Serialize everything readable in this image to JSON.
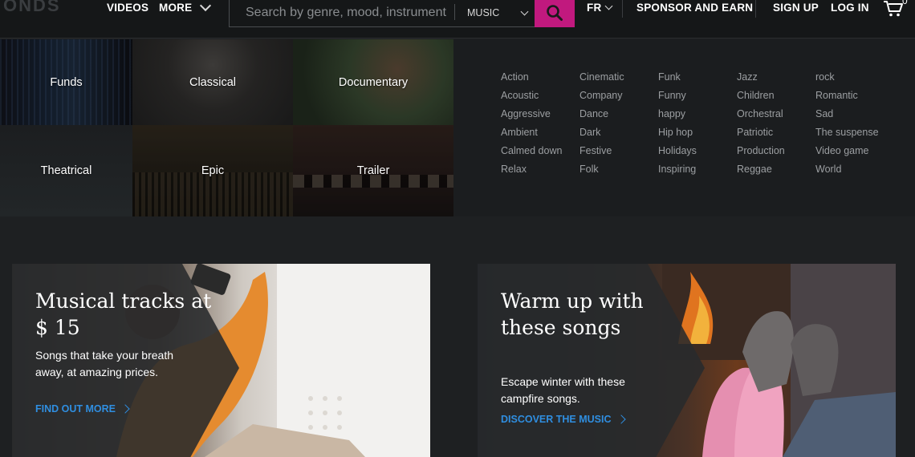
{
  "header": {
    "logo_text": "ONDS",
    "nav": {
      "videos": "VIDEOS",
      "more": "MORE",
      "language": "FR",
      "sponsor": "SPONSOR AND EARN",
      "signup": "SIGN UP",
      "login": "LOG IN"
    },
    "search": {
      "placeholder": "Search by genre, mood, instrument",
      "category": "MUSIC"
    },
    "cart_count": "0",
    "accent_color": "#c1197e"
  },
  "mega_menu": {
    "tiles": [
      {
        "label": "Funds"
      },
      {
        "label": "Classical"
      },
      {
        "label": "Documentary"
      },
      {
        "label": "Theatrical"
      },
      {
        "label": "Epic"
      },
      {
        "label": "Trailer"
      }
    ],
    "genres": [
      "Action",
      "Cinematic",
      "Funk",
      "Jazz",
      "rock",
      "Acoustic",
      "Company",
      "Funny",
      "Children",
      "Romantic",
      "Aggressive",
      "Dance",
      "happy",
      "Orchestral",
      "Sad",
      "Ambient",
      "Dark",
      "Hip hop",
      "Patriotic",
      "The suspense",
      "Calmed down",
      "Festive",
      "Holidays",
      "Production",
      "Video game",
      "Relax",
      "Folk",
      "Inspiring",
      "Reggae",
      "World"
    ]
  },
  "promos": [
    {
      "title": "Musical tracks at $ 15",
      "text": "Songs that take your breath away, at amazing prices.",
      "link": "FIND OUT MORE"
    },
    {
      "title": "Warm up with these songs",
      "text": "Escape winter with these campfire songs.",
      "link": "DISCOVER THE MUSIC"
    }
  ],
  "link_color": "#2f8ee0"
}
